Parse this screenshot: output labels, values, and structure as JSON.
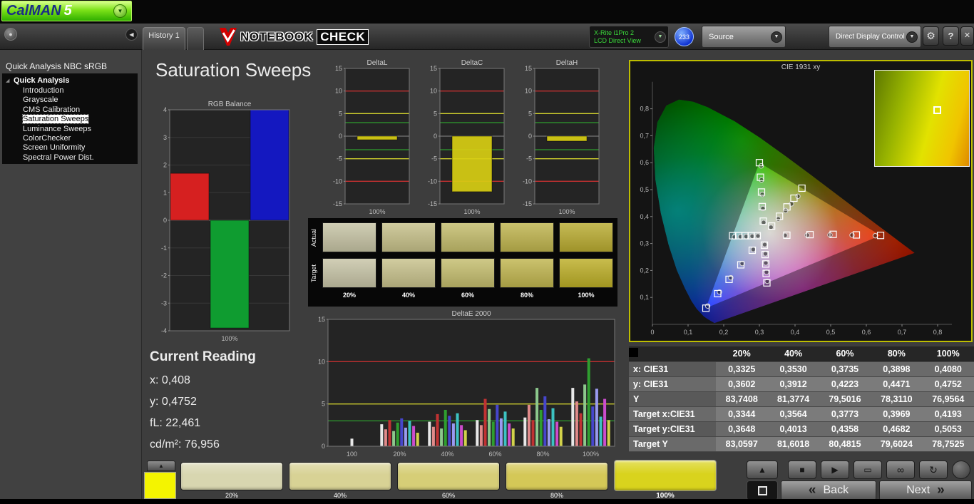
{
  "app": {
    "logo_name": "CalMAN",
    "logo_version": "5"
  },
  "toolbar": {
    "history_tab": "History 1",
    "brand_notebook": "NOTEBOOK",
    "brand_check": "CHECK",
    "meter_line1": "X-Rite i1Pro 2",
    "meter_line2": "LCD Direct View",
    "meter_badge": "233",
    "source_label": "Source",
    "display_label": "Direct Display Control"
  },
  "sidebar": {
    "title": "Quick Analysis NBC sRGB",
    "root_item": "Quick Analysis",
    "items": [
      {
        "label": "Introduction",
        "selected": false
      },
      {
        "label": "Grayscale",
        "selected": false
      },
      {
        "label": "CMS Calibration",
        "selected": false
      },
      {
        "label": "Saturation Sweeps",
        "selected": true
      },
      {
        "label": "Luminance Sweeps",
        "selected": false
      },
      {
        "label": "ColorChecker",
        "selected": false
      },
      {
        "label": "Screen Uniformity",
        "selected": false
      },
      {
        "label": "Spectral Power Dist.",
        "selected": false
      }
    ]
  },
  "main": {
    "title": "Saturation Sweeps"
  },
  "current_reading": {
    "title": "Current Reading",
    "x_label": "x:",
    "x_value": "0,408",
    "y_label": "y:",
    "y_value": "0,4752",
    "fl_label": "fL:",
    "fl_value": "22,461",
    "cd_label": "cd/m²:",
    "cd_value": "76,956"
  },
  "swatch_panel": {
    "row_labels": [
      "Actual",
      "Target"
    ],
    "col_labels": [
      "20%",
      "40%",
      "60%",
      "80%",
      "100%"
    ],
    "actual_colors": [
      "#c6c3a4",
      "#c6c089",
      "#c3bc6b",
      "#bfb44d",
      "#b9ab30"
    ],
    "target_colors": [
      "#c7c4a6",
      "#c7c18b",
      "#c4bd6d",
      "#c0b54e",
      "#bcae26"
    ]
  },
  "table": {
    "col_headers": [
      "",
      "20%",
      "40%",
      "60%",
      "80%",
      "100%"
    ],
    "rows": [
      {
        "label": "x: CIE31",
        "values": [
          "0,3325",
          "0,3530",
          "0,3735",
          "0,3898",
          "0,4080"
        ]
      },
      {
        "label": "y: CIE31",
        "values": [
          "0,3602",
          "0,3912",
          "0,4223",
          "0,4471",
          "0,4752"
        ]
      },
      {
        "label": "Y",
        "values": [
          "83,7408",
          "81,3774",
          "79,5016",
          "78,3110",
          "76,9564"
        ]
      },
      {
        "label": "Target x:CIE31",
        "values": [
          "0,3344",
          "0,3564",
          "0,3773",
          "0,3969",
          "0,4193"
        ]
      },
      {
        "label": "Target y:CIE31",
        "values": [
          "0,3648",
          "0,4013",
          "0,4358",
          "0,4682",
          "0,5053"
        ]
      },
      {
        "label": "Target Y",
        "values": [
          "83,0597",
          "81,6018",
          "80,4815",
          "79,6024",
          "78,7525"
        ]
      }
    ]
  },
  "bottom": {
    "current_color": "#f4f400",
    "swatches": [
      {
        "label": "20%",
        "color": "#d8d6b0",
        "active": false
      },
      {
        "label": "40%",
        "color": "#d8d295",
        "active": false
      },
      {
        "label": "60%",
        "color": "#d6ce77",
        "active": false
      },
      {
        "label": "80%",
        "color": "#d4c857",
        "active": false
      },
      {
        "label": "100%",
        "color": "#d9d31d",
        "active": true
      }
    ],
    "back_label": "Back",
    "next_label": "Next"
  },
  "icons": {
    "logo_dropdown": "▼",
    "collapse_dot": "●",
    "collapse_left": "◀",
    "dropdown_arrow": "▼",
    "gear": "⚙",
    "help": "?",
    "close": "✕",
    "expander": "◢",
    "up_arrow": "▲",
    "stop": "■",
    "play": "▶",
    "pattern_window": "▭",
    "link": "∞",
    "loop": "↻",
    "back_chevron": "«",
    "next_chevron": "»"
  },
  "chart_data": [
    {
      "id": "rgb_balance",
      "type": "bar",
      "title": "RGB Balance",
      "categories": [
        "Red",
        "Green",
        "Blue"
      ],
      "values": [
        1.7,
        -3.9,
        4.2
      ],
      "colors": [
        "#d62020",
        "#0f9c30",
        "#1418c0"
      ],
      "ylim": [
        -4,
        4
      ],
      "yticks": [
        4,
        3,
        2,
        1,
        0,
        -1,
        -2,
        -3,
        -4
      ],
      "xlabel": "100%"
    },
    {
      "id": "deltaL",
      "type": "bar",
      "title": "DeltaL",
      "categories": [
        "100%"
      ],
      "values": [
        -0.8
      ],
      "colors": [
        "#d8ce14"
      ],
      "ylim": [
        -15,
        15
      ],
      "yticks": [
        15,
        10,
        5,
        0,
        -5,
        -10,
        -15
      ],
      "ref_lines": [
        {
          "y": 10,
          "color": "#c23030"
        },
        {
          "y": 5,
          "color": "#cfcf2e"
        },
        {
          "y": 3,
          "color": "#2f9e2f"
        },
        {
          "y": -3,
          "color": "#2f9e2f"
        },
        {
          "y": -5,
          "color": "#cfcf2e"
        },
        {
          "y": -10,
          "color": "#c23030"
        }
      ],
      "xlabel": "100%"
    },
    {
      "id": "deltaC",
      "type": "bar",
      "title": "DeltaC",
      "categories": [
        "100%"
      ],
      "values": [
        -12.3
      ],
      "colors": [
        "#d8ce14"
      ],
      "ylim": [
        -15,
        15
      ],
      "yticks": [
        15,
        10,
        5,
        0,
        -5,
        -10,
        -15
      ],
      "ref_lines": [
        {
          "y": 10,
          "color": "#c23030"
        },
        {
          "y": 5,
          "color": "#cfcf2e"
        },
        {
          "y": 3,
          "color": "#2f9e2f"
        },
        {
          "y": -3,
          "color": "#2f9e2f"
        },
        {
          "y": -5,
          "color": "#cfcf2e"
        },
        {
          "y": -10,
          "color": "#c23030"
        }
      ],
      "xlabel": "100%"
    },
    {
      "id": "deltaH",
      "type": "bar",
      "title": "DeltaH",
      "categories": [
        "100%"
      ],
      "values": [
        -1.1
      ],
      "colors": [
        "#d8ce14"
      ],
      "ylim": [
        -15,
        15
      ],
      "yticks": [
        15,
        10,
        5,
        0,
        -5,
        -10,
        -15
      ],
      "ref_lines": [
        {
          "y": 10,
          "color": "#c23030"
        },
        {
          "y": 5,
          "color": "#cfcf2e"
        },
        {
          "y": 3,
          "color": "#2f9e2f"
        },
        {
          "y": -3,
          "color": "#2f9e2f"
        },
        {
          "y": -5,
          "color": "#cfcf2e"
        },
        {
          "y": -10,
          "color": "#c23030"
        }
      ],
      "xlabel": "100%"
    },
    {
      "id": "deltaE2000",
      "type": "bar",
      "title": "DeltaE 2000",
      "categories": [
        "100",
        "20%",
        "40%",
        "60%",
        "80%",
        "100%"
      ],
      "series_colors": [
        "#e8e8e8",
        "#e08a8a",
        "#c03232",
        "#8cc88c",
        "#2f9e2f",
        "#4646cc",
        "#9a9af0",
        "#3cc2c2",
        "#cc4ccc",
        "#d2d24a"
      ],
      "groups": [
        [
          0.9
        ],
        [
          2.6,
          2.0,
          3.1,
          1.8,
          2.8,
          3.3,
          2.2,
          3.0,
          2.4,
          1.6
        ],
        [
          2.9,
          2.3,
          3.8,
          2.1,
          4.3,
          3.6,
          2.7,
          3.9,
          2.5,
          1.9
        ],
        [
          3.1,
          2.5,
          5.6,
          4.4,
          2.9,
          4.9,
          3.3,
          4.1,
          2.7,
          2.1
        ],
        [
          3.4,
          4.9,
          3.1,
          6.9,
          4.3,
          5.9,
          3.2,
          4.5,
          2.9,
          2.3
        ],
        [
          6.9,
          5.3,
          3.9,
          7.3,
          10.4,
          4.7,
          6.8,
          3.5,
          5.6,
          3.1
        ]
      ],
      "ylim": [
        0,
        15
      ],
      "yticks": [
        15,
        10,
        5,
        0
      ],
      "ref_lines": [
        {
          "y": 10,
          "color": "#c23030"
        },
        {
          "y": 5,
          "color": "#cfcf2e"
        },
        {
          "y": 3,
          "color": "#2f9e2f"
        }
      ]
    },
    {
      "id": "cie1931",
      "type": "scatter",
      "title": "CIE 1931 xy",
      "xlim": [
        0,
        0.85
      ],
      "ylim": [
        0,
        0.9
      ],
      "xtick_labels": [
        "0",
        "0,1",
        "0,2",
        "0,3",
        "0,4",
        "0,5",
        "0,6",
        "0,7",
        "0,8"
      ],
      "ytick_labels": [
        "0,1",
        "0,2",
        "0,3",
        "0,4",
        "0,5",
        "0,6",
        "0,7",
        "0,8"
      ],
      "gamut_triangle": [
        [
          0.64,
          0.33
        ],
        [
          0.3,
          0.6
        ],
        [
          0.15,
          0.06
        ]
      ],
      "targets": [
        [
          0.3344,
          0.3648
        ],
        [
          0.3564,
          0.4013
        ],
        [
          0.3773,
          0.4358
        ],
        [
          0.3969,
          0.4682
        ],
        [
          0.4193,
          0.5053
        ],
        [
          0.377,
          0.331
        ],
        [
          0.442,
          0.333
        ],
        [
          0.507,
          0.334
        ],
        [
          0.572,
          0.332
        ],
        [
          0.64,
          0.33
        ],
        [
          0.311,
          0.383
        ],
        [
          0.308,
          0.437
        ],
        [
          0.306,
          0.491
        ],
        [
          0.303,
          0.546
        ],
        [
          0.3,
          0.6
        ],
        [
          0.28,
          0.275
        ],
        [
          0.248,
          0.221
        ],
        [
          0.215,
          0.167
        ],
        [
          0.183,
          0.114
        ],
        [
          0.15,
          0.06
        ],
        [
          0.294,
          0.329
        ],
        [
          0.277,
          0.329
        ],
        [
          0.26,
          0.329
        ],
        [
          0.242,
          0.329
        ],
        [
          0.225,
          0.329
        ],
        [
          0.314,
          0.294
        ],
        [
          0.316,
          0.259
        ],
        [
          0.318,
          0.224
        ],
        [
          0.319,
          0.189
        ],
        [
          0.321,
          0.154
        ]
      ],
      "measured": [
        [
          0.3325,
          0.3602
        ],
        [
          0.353,
          0.3912
        ],
        [
          0.3735,
          0.4223
        ],
        [
          0.3898,
          0.4471
        ],
        [
          0.408,
          0.4752
        ],
        [
          0.372,
          0.33
        ],
        [
          0.434,
          0.331
        ],
        [
          0.498,
          0.332
        ],
        [
          0.56,
          0.331
        ],
        [
          0.625,
          0.329
        ],
        [
          0.312,
          0.378
        ],
        [
          0.31,
          0.43
        ],
        [
          0.308,
          0.482
        ],
        [
          0.306,
          0.536
        ],
        [
          0.305,
          0.588
        ],
        [
          0.283,
          0.278
        ],
        [
          0.252,
          0.226
        ],
        [
          0.22,
          0.173
        ],
        [
          0.188,
          0.12
        ],
        [
          0.155,
          0.068
        ],
        [
          0.296,
          0.328
        ],
        [
          0.28,
          0.327
        ],
        [
          0.263,
          0.326
        ],
        [
          0.247,
          0.325
        ],
        [
          0.23,
          0.324
        ],
        [
          0.315,
          0.296
        ],
        [
          0.317,
          0.262
        ],
        [
          0.318,
          0.228
        ],
        [
          0.32,
          0.194
        ],
        [
          0.322,
          0.16
        ]
      ]
    }
  ]
}
